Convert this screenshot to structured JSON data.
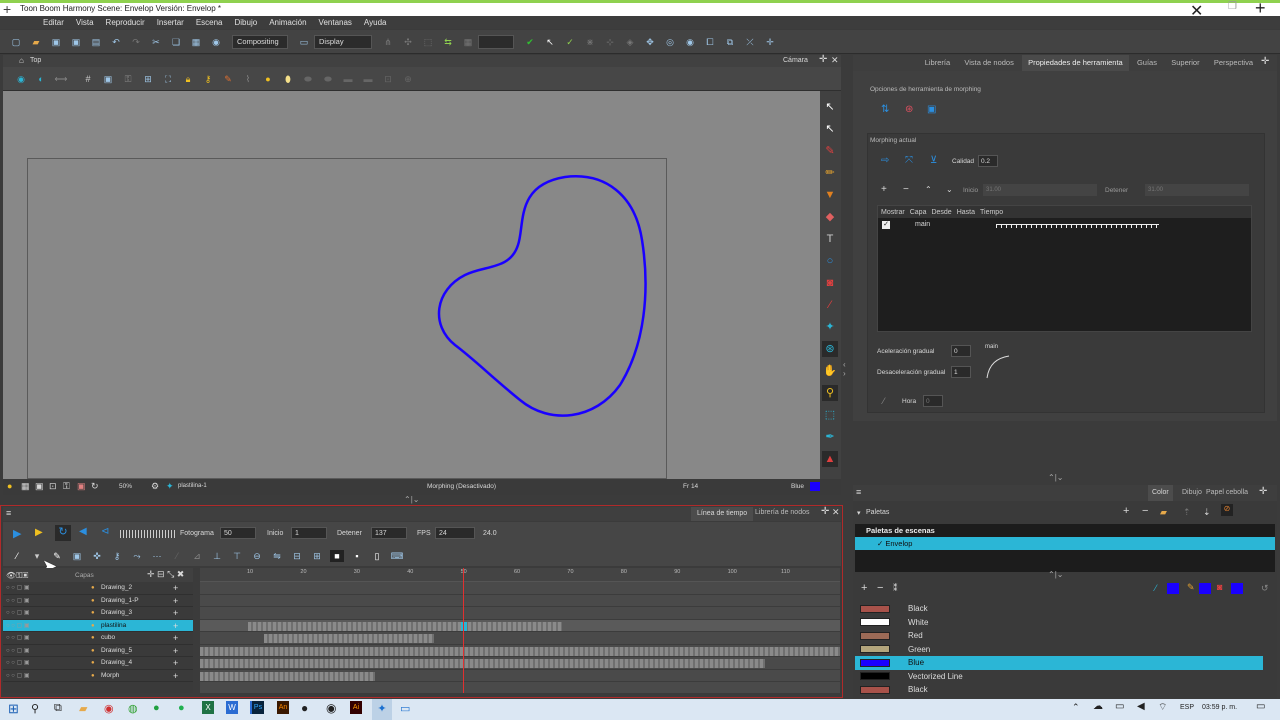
{
  "window": {
    "title": "Toon Boom Harmony Scene: Envelop Versión: Envelop *"
  },
  "menu": [
    "Editar",
    "Vista",
    "Reproducir",
    "Insertar",
    "Escena",
    "Dibujo",
    "Animación",
    "Ventanas",
    "Ayuda"
  ],
  "toolbar": {
    "workspace": "Compositing",
    "display": "Display"
  },
  "camera": {
    "view_label": "Top",
    "panel_label": "Cámara",
    "zoom": "50%",
    "layer": "plastilina-1",
    "status": "Morphing (Desactivado)",
    "frame": "Fr 14",
    "color": "Blue"
  },
  "timeline": {
    "tabs": [
      "Línea de tiempo",
      "Librería de nodos"
    ],
    "frame_label": "Fotograma",
    "frame_value": "50",
    "start_label": "Inicio",
    "start_value": "1",
    "stop_label": "Detener",
    "stop_value": "137",
    "fps_label": "FPS",
    "fps_value": "24",
    "fps_readout": "24.0",
    "layers_header": "Capas",
    "ruler": [
      "10",
      "20",
      "30",
      "40",
      "50",
      "60",
      "70",
      "80",
      "90",
      "100",
      "110"
    ],
    "layers": [
      "Drawing_2",
      "Drawing_1-P",
      "Drawing_3",
      "plastilina",
      "cubo",
      "Drawing_5",
      "Drawing_4",
      "Morph"
    ]
  },
  "right_tabs": [
    "Librería",
    "Vista de nodos",
    "Propiedades de herramienta",
    "Guías",
    "Superior",
    "Perspectiva"
  ],
  "tool_props": {
    "morph_options": "Opciones de herramienta de morphing",
    "current": "Morphing actual",
    "quality_label": "Calidad",
    "quality_value": "0.2",
    "start_label": "Inicio",
    "start_value": "31.00",
    "stop_label": "Detener",
    "stop_value": "31.00",
    "cols": [
      "Mostrar",
      "Capa",
      "Desde",
      "Hasta",
      "Tiempo"
    ],
    "row_layer": "main",
    "ease_in_label": "Aceleración gradual",
    "ease_in_value": "0",
    "ease_out_label": "Desaceleración gradual",
    "ease_out_value": "1",
    "ease_caption": "main",
    "hint_label": "Hora",
    "hint_value": "0"
  },
  "palette_tabs": [
    "Color",
    "Dibujo",
    "Papel cebolla"
  ],
  "palettes": {
    "title": "Paletas",
    "scene_header": "Paletas de escenas",
    "scene_item": "Envelop",
    "colors": [
      {
        "name": "Black",
        "hex": "#a8524a"
      },
      {
        "name": "White",
        "hex": "#ffffff"
      },
      {
        "name": "Red",
        "hex": "#9c6a56"
      },
      {
        "name": "Green",
        "hex": "#b3a57c"
      },
      {
        "name": "Blue",
        "hex": "#1a00ff"
      },
      {
        "name": "Vectorized Line",
        "hex": "#000000"
      },
      {
        "name": "Black",
        "hex": "#a8524a"
      }
    ]
  },
  "taskbar": {
    "lang": "ESP",
    "time": "03:59 p. m."
  },
  "accent": "#2bb6d6"
}
